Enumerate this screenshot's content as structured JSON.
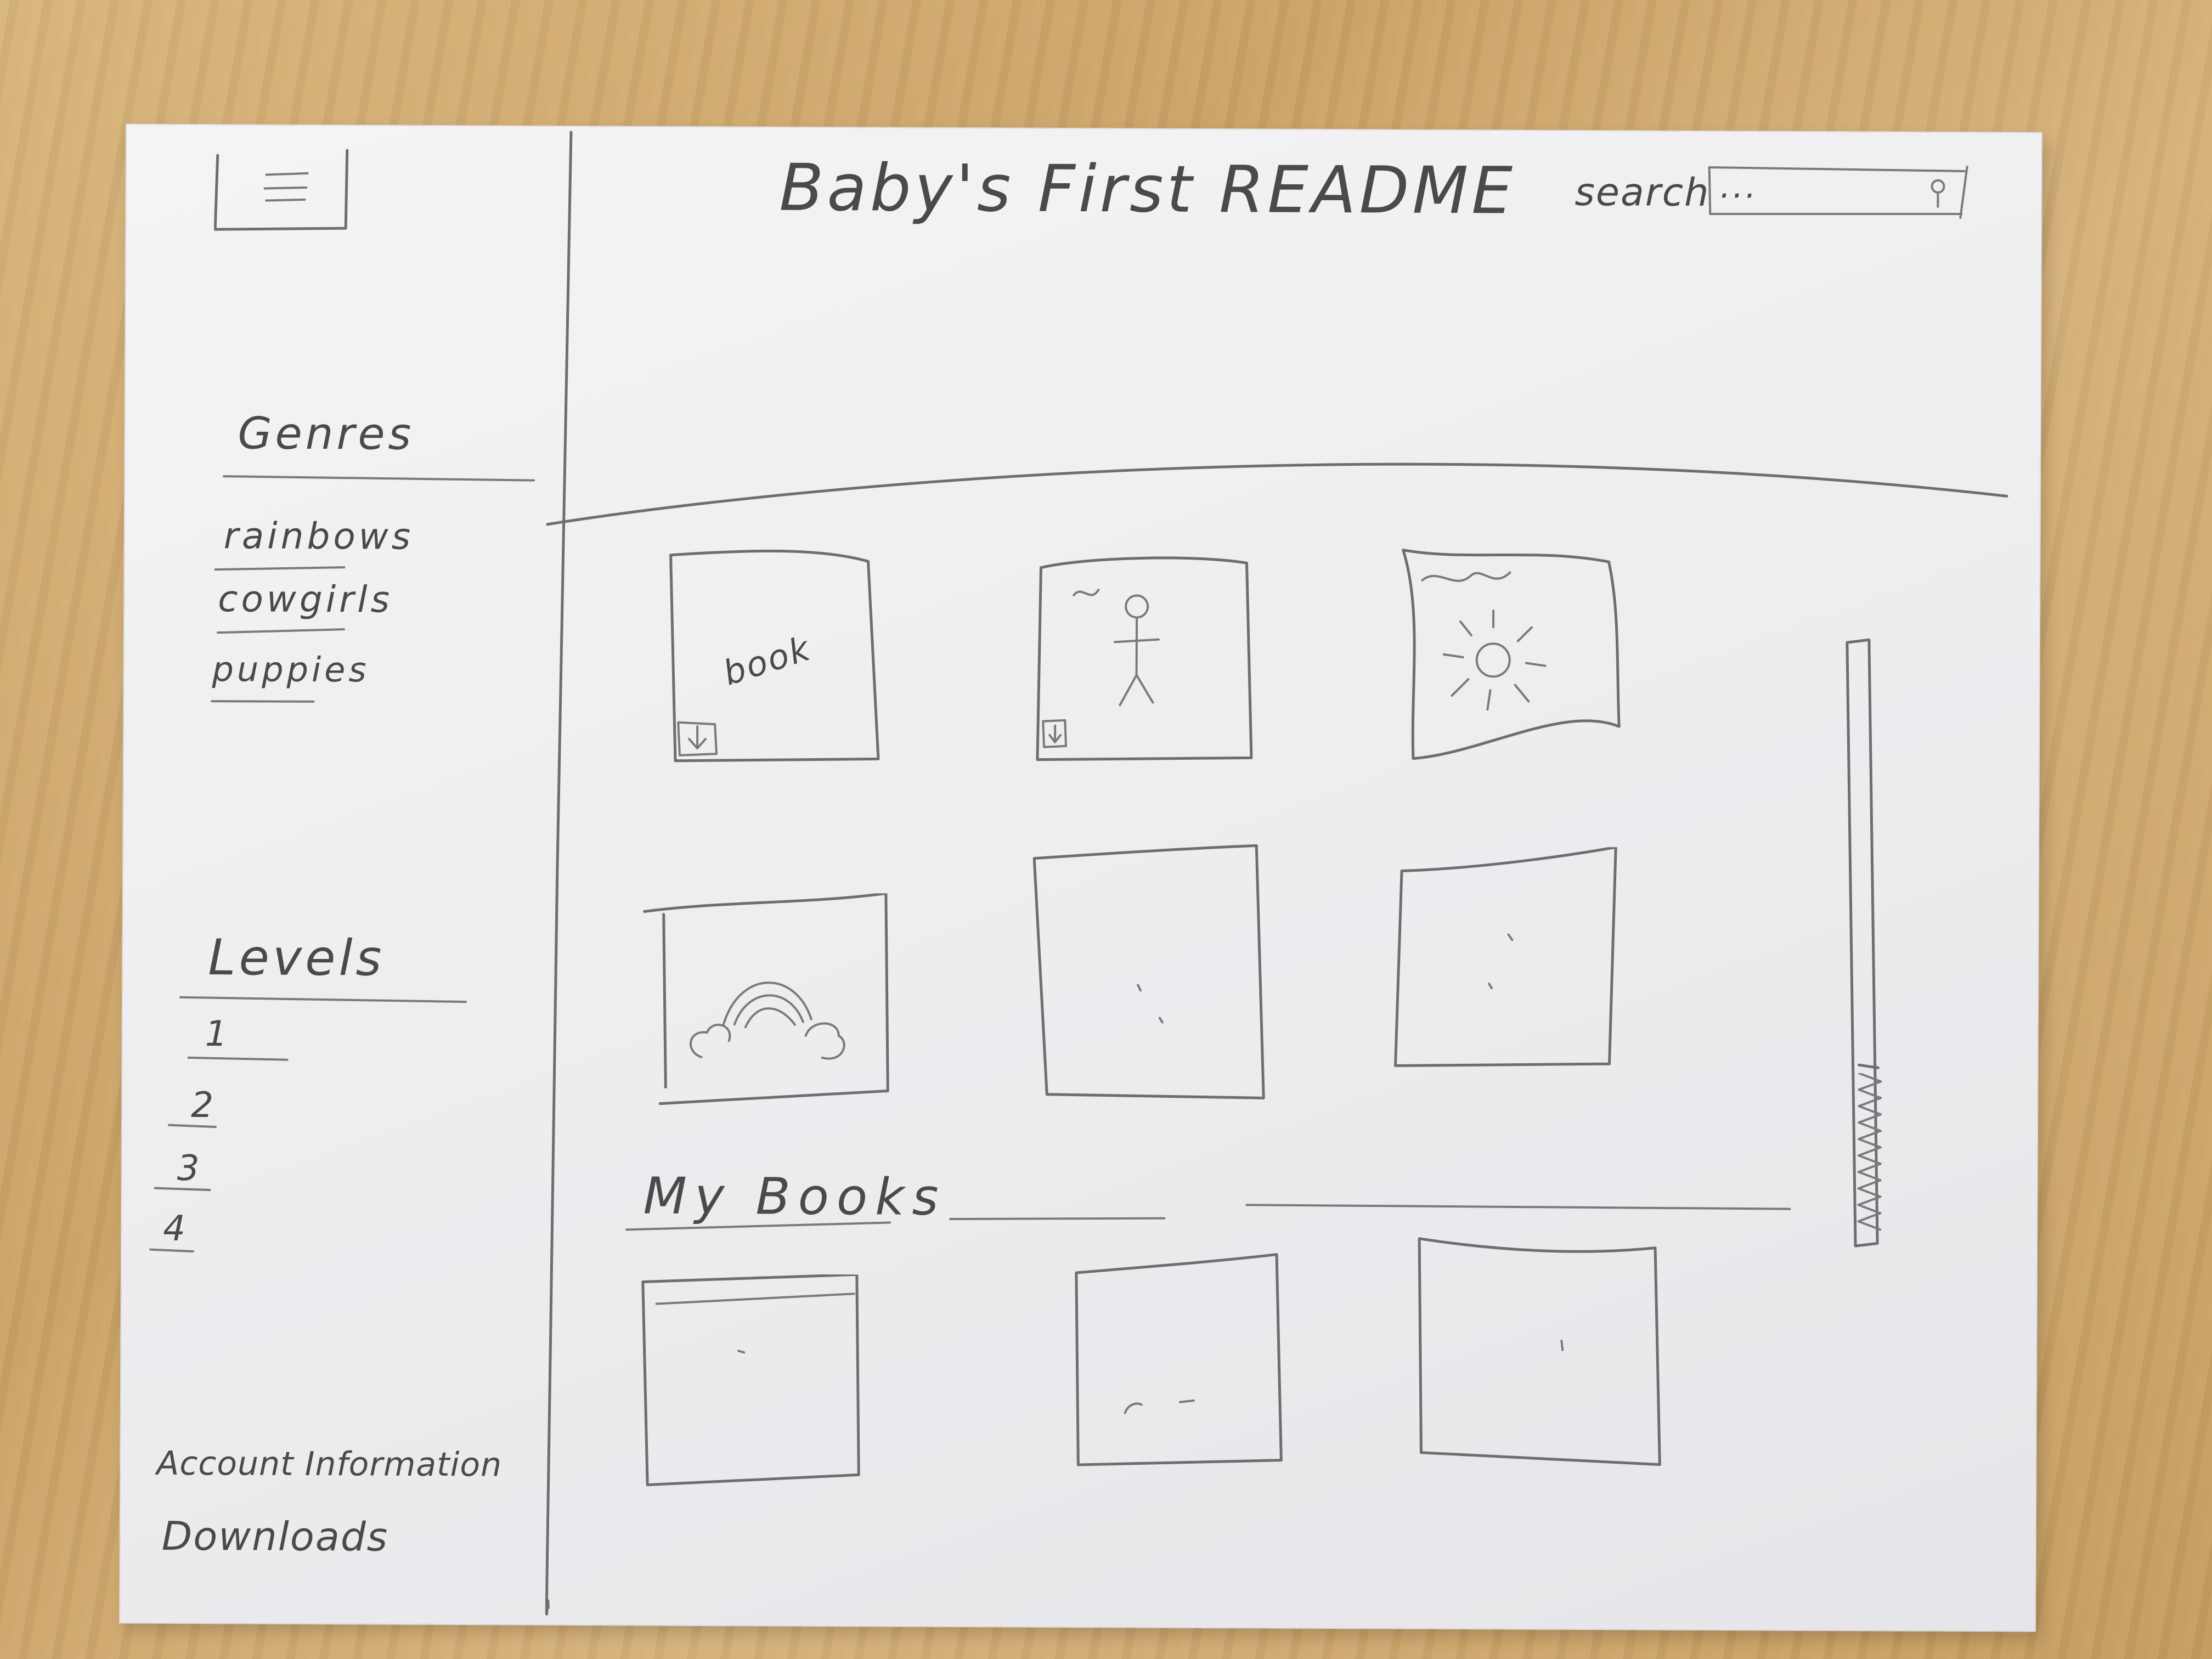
{
  "header": {
    "menu_icon": "hamburger-menu-icon",
    "app_title": "Baby's First README",
    "search": {
      "label": "search",
      "placeholder": "...",
      "icon": "magnifier-icon"
    }
  },
  "sidebar": {
    "genres": {
      "heading": "Genres",
      "items": [
        "rainbows",
        "cowgirls",
        "puppies"
      ]
    },
    "levels": {
      "heading": "Levels",
      "items": [
        "1",
        "2",
        "3",
        "4"
      ]
    },
    "footer_links": [
      "Account Information",
      "Downloads"
    ]
  },
  "main": {
    "book_grid": [
      {
        "cover_text": "book",
        "download_icon": "download-icon"
      },
      {
        "cover_art": "stick-figure",
        "download_icon": "download-icon"
      },
      {
        "cover_art": "sun"
      },
      {
        "cover_art": "rainbow-clouds"
      },
      {
        "cover_art": "blank"
      },
      {
        "cover_art": "blank"
      }
    ],
    "my_books": {
      "heading": "My Books",
      "items": [
        "book",
        "book",
        "book"
      ]
    }
  },
  "scrollbar": {
    "icon": "scrollbar-thumb"
  }
}
